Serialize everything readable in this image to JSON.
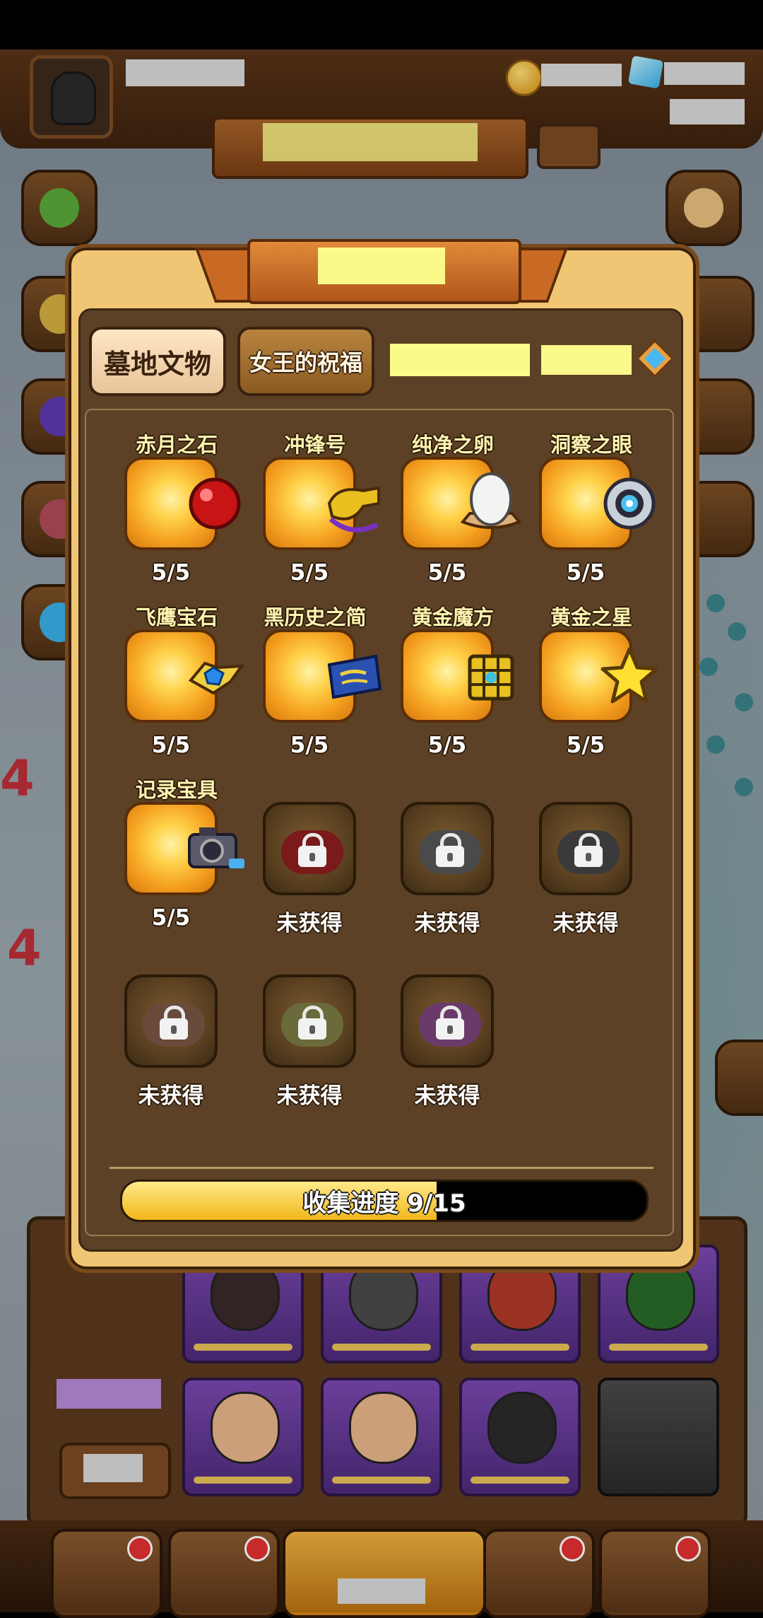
{
  "modal": {
    "tabs": [
      {
        "label": "墓地文物",
        "active": true
      },
      {
        "label": "女王的祝福",
        "active": false
      }
    ],
    "items": [
      {
        "name": "赤月之石",
        "count": "5/5",
        "owned": true,
        "icon": "red-orb-icon"
      },
      {
        "name": "冲锋号",
        "count": "5/5",
        "owned": true,
        "icon": "whistle-icon"
      },
      {
        "name": "纯净之卵",
        "count": "5/5",
        "owned": true,
        "icon": "egg-icon"
      },
      {
        "name": "洞察之眼",
        "count": "5/5",
        "owned": true,
        "icon": "eye-lens-icon"
      },
      {
        "name": "飞鹰宝石",
        "count": "5/5",
        "owned": true,
        "icon": "winged-gem-icon"
      },
      {
        "name": "黑历史之简",
        "count": "5/5",
        "owned": true,
        "icon": "scroll-icon"
      },
      {
        "name": "黄金魔方",
        "count": "5/5",
        "owned": true,
        "icon": "golden-cube-icon"
      },
      {
        "name": "黄金之星",
        "count": "5/5",
        "owned": true,
        "icon": "golden-star-icon"
      },
      {
        "name": "记录宝具",
        "count": "5/5",
        "owned": true,
        "icon": "camera-icon"
      },
      {
        "name": "",
        "count": "未获得",
        "owned": false,
        "icon": "lock-icon"
      },
      {
        "name": "",
        "count": "未获得",
        "owned": false,
        "icon": "lock-icon"
      },
      {
        "name": "",
        "count": "未获得",
        "owned": false,
        "icon": "lock-icon"
      },
      {
        "name": "",
        "count": "未获得",
        "owned": false,
        "icon": "lock-icon"
      },
      {
        "name": "",
        "count": "未获得",
        "owned": false,
        "icon": "lock-icon"
      },
      {
        "name": "",
        "count": "未获得",
        "owned": false,
        "icon": "lock-icon"
      }
    ],
    "progress": {
      "label": "收集进度 9/15",
      "collected": 9,
      "total": 15
    }
  },
  "colors": {
    "modal_bg": "#f0c675",
    "inner_bg": "#5c4126",
    "owned_tile": "#f4a020",
    "locked_tile": "#5a4020",
    "progress_fill": "#f2b81a"
  }
}
